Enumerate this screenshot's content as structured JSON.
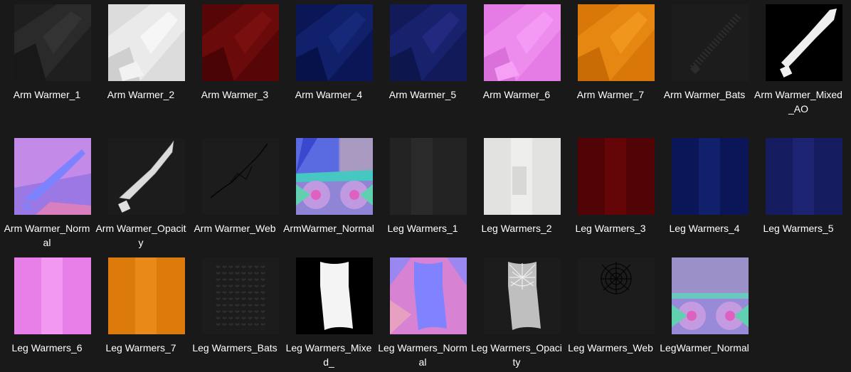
{
  "files": [
    {
      "name": "Arm Warmer_1",
      "icon": "arm-warmer-texture-dark-icon",
      "color": "#262626"
    },
    {
      "name": "Arm Warmer_2",
      "icon": "arm-warmer-texture-white-icon",
      "color": "#e4e4e4"
    },
    {
      "name": "Arm Warmer_3",
      "icon": "arm-warmer-texture-red-icon",
      "color": "#5e0708"
    },
    {
      "name": "Arm Warmer_4",
      "icon": "arm-warmer-texture-navy-icon",
      "color": "#0c1a5e"
    },
    {
      "name": "Arm Warmer_5",
      "icon": "arm-warmer-texture-blue-icon",
      "color": "#141c63"
    },
    {
      "name": "Arm Warmer_6",
      "icon": "arm-warmer-texture-pink-icon",
      "color": "#ea80ea"
    },
    {
      "name": "Arm Warmer_7",
      "icon": "arm-warmer-texture-orange-icon",
      "color": "#e07f10"
    },
    {
      "name": "Arm Warmer_Bats",
      "icon": "arm-warmer-bats-mask-icon",
      "color": "#1e1e1e"
    },
    {
      "name": "Arm Warmer_Mixed_AO",
      "icon": "arm-warmer-ao-mask-icon",
      "color": "#000000"
    },
    {
      "name": "Arm Warmer_Normal",
      "icon": "arm-warmer-normal-map-icon",
      "color": "#b37be8"
    },
    {
      "name": "Arm Warmer_Opacity",
      "icon": "arm-warmer-opacity-mask-icon",
      "color": "#1e1e1e"
    },
    {
      "name": "Arm Warmer_Web",
      "icon": "arm-warmer-web-mask-icon",
      "color": "#1e1e1e"
    },
    {
      "name": "ArmWarmer_Normal",
      "icon": "armwarmer-normal-map-icon",
      "color": "#8a7ad8"
    },
    {
      "name": "Leg Warmers_1",
      "icon": "leg-warmers-texture-dark-icon",
      "color": "#262626"
    },
    {
      "name": "Leg Warmers_2",
      "icon": "leg-warmers-texture-white-icon",
      "color": "#e6e6e4"
    },
    {
      "name": "Leg Warmers_3",
      "icon": "leg-warmers-texture-red-icon",
      "color": "#5a0406"
    },
    {
      "name": "Leg Warmers_4",
      "icon": "leg-warmers-texture-navy-icon",
      "color": "#0c1a60"
    },
    {
      "name": "Leg Warmers_5",
      "icon": "leg-warmers-texture-blue-icon",
      "color": "#161c66"
    },
    {
      "name": "Leg Warmers_6",
      "icon": "leg-warmers-texture-pink-icon",
      "color": "#ec84ec"
    },
    {
      "name": "Leg Warmers_7",
      "icon": "leg-warmers-texture-orange-icon",
      "color": "#e37e12"
    },
    {
      "name": "Leg Warmers_Bats",
      "icon": "leg-warmers-bats-mask-icon",
      "color": "#1e1e1e"
    },
    {
      "name": "Leg Warmers_Mixed_",
      "icon": "leg-warmers-ao-mask-icon",
      "color": "#000000"
    },
    {
      "name": "Leg Warmers_Normal",
      "icon": "leg-warmers-normal-map-icon",
      "color": "#8080ff"
    },
    {
      "name": "Leg Warmers_Opacity",
      "icon": "leg-warmers-opacity-mask-icon",
      "color": "#1e1e1e"
    },
    {
      "name": "Leg Warmers_Web",
      "icon": "leg-warmers-web-mask-icon",
      "color": "#1e1e1e"
    },
    {
      "name": "LegWarmer_Normal",
      "icon": "legwarmer-normal-map-icon",
      "color": "#9a8ad8"
    }
  ]
}
